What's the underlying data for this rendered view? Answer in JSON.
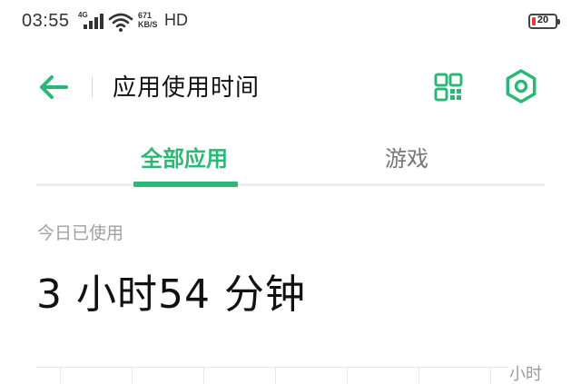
{
  "status_bar": {
    "time": "03:55",
    "network": "4G",
    "speed_value": "671",
    "speed_unit": "KB/S",
    "hd": "HD",
    "battery_percent": "20",
    "battery_color": "#e53935"
  },
  "header": {
    "title": "应用使用时间",
    "back_icon": "arrow-left-icon",
    "qr_icon": "qr-code-icon",
    "settings_icon": "hexagon-settings-icon"
  },
  "tabs": [
    {
      "label": "全部应用",
      "selected": true
    },
    {
      "label": "游戏",
      "selected": false
    }
  ],
  "usage": {
    "today_label": "今日已使用",
    "total": "3 小时54 分钟"
  },
  "chart": {
    "unit_label": "小时"
  },
  "colors": {
    "accent": "#2bb877",
    "divider": "#ededed",
    "muted_text": "#a0a0a0"
  }
}
